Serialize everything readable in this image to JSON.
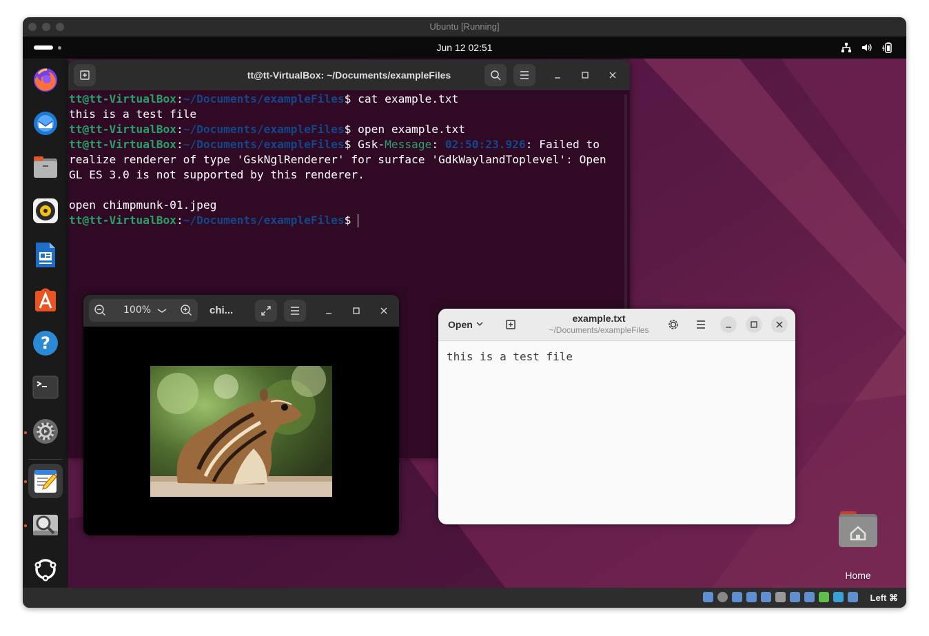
{
  "vbox": {
    "title": "Ubuntu [Running]",
    "host_key": "Left ⌘"
  },
  "topbar": {
    "clock": "Jun 12  02:51"
  },
  "terminal": {
    "title": "tt@tt-VirtualBox: ~/Documents/exampleFiles",
    "prompt_user": "tt@tt-VirtualBox",
    "prompt_path": "~/Documents/exampleFiles",
    "lines": [
      {
        "cmd": "cat example.txt"
      },
      {
        "out": "this is a test file"
      },
      {
        "cmd": "open example.txt"
      },
      {
        "cmd": "Gsk-",
        "gsk_tag": "Message",
        "gsk_time": "02:50:23.926",
        "gsk_rest": ": Failed to"
      },
      {
        "out": "realize renderer of type 'GskNglRenderer' for surface 'GdkWaylandToplevel': Open"
      },
      {
        "out": "GL ES 3.0 is not supported by this renderer."
      },
      {
        "out": ""
      },
      {
        "out": "open chimpmunk-01.jpeg"
      }
    ]
  },
  "image_viewer": {
    "zoom": "100%",
    "title": "chi..."
  },
  "text_editor": {
    "open_label": "Open",
    "title": "example.txt",
    "subtitle": "~/Documents/exampleFiles",
    "content": "this is a test file"
  },
  "desktop": {
    "home_label": "Home"
  },
  "dock": {
    "items": [
      {
        "name": "firefox-icon",
        "color": "#ff7139"
      },
      {
        "name": "thunderbird-icon",
        "color": "#1f78d1"
      },
      {
        "name": "files-icon",
        "color": "#9a9a9a"
      },
      {
        "name": "rhythmbox-icon",
        "color": "#f5c211"
      },
      {
        "name": "writer-icon",
        "color": "#1f6ec6"
      },
      {
        "name": "app-center-icon",
        "color": "#e95420"
      },
      {
        "name": "help-icon",
        "color": "#2a8ad6"
      },
      {
        "name": "terminal-icon",
        "color": "#3a3a3a"
      },
      {
        "name": "settings-icon",
        "color": "#8c8c8c"
      },
      {
        "name": "text-editor-icon",
        "color": "#3584e4"
      },
      {
        "name": "image-viewer-icon",
        "color": "#a6a6a6"
      },
      {
        "name": "ubuntu-logo-icon",
        "color": "#ffffff"
      }
    ]
  }
}
